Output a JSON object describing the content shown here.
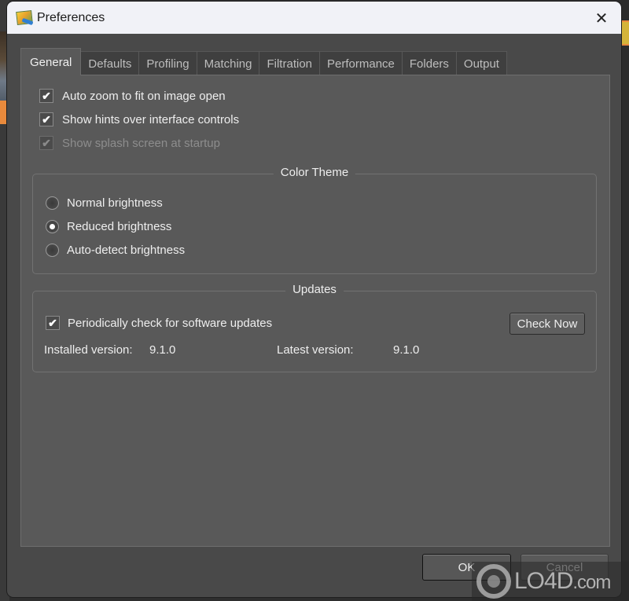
{
  "window": {
    "title": "Preferences",
    "close_label": "✕",
    "app_icon": "photo-editor-icon"
  },
  "tabs": [
    {
      "label": "General",
      "active": true
    },
    {
      "label": "Defaults",
      "active": false
    },
    {
      "label": "Profiling",
      "active": false
    },
    {
      "label": "Matching",
      "active": false
    },
    {
      "label": "Filtration",
      "active": false
    },
    {
      "label": "Performance",
      "active": false
    },
    {
      "label": "Folders",
      "active": false
    },
    {
      "label": "Output",
      "active": false
    }
  ],
  "general": {
    "options": [
      {
        "label": "Auto zoom to fit on image open",
        "checked": true,
        "enabled": true,
        "mark": "✔"
      },
      {
        "label": "Show hints over interface controls",
        "checked": true,
        "enabled": true,
        "mark": "✔"
      },
      {
        "label": "Show splash screen at startup",
        "checked": true,
        "enabled": false,
        "mark": "✔"
      }
    ],
    "color_theme": {
      "title": "Color Theme",
      "options": [
        {
          "label": "Normal brightness",
          "selected": false
        },
        {
          "label": "Reduced brightness",
          "selected": true
        },
        {
          "label": "Auto-detect brightness",
          "selected": false
        }
      ]
    },
    "updates": {
      "title": "Updates",
      "periodic_check": {
        "label": "Periodically check for software updates",
        "checked": true,
        "mark": "✔"
      },
      "check_now_label": "Check Now",
      "installed_label": "Installed version:",
      "installed_value": "9.1.0",
      "latest_label": "Latest version:",
      "latest_value": "9.1.0"
    }
  },
  "footer": {
    "ok_label": "OK",
    "cancel_label": "Cancel"
  },
  "watermark": {
    "text": "LO4D",
    "suffix": ".com"
  }
}
